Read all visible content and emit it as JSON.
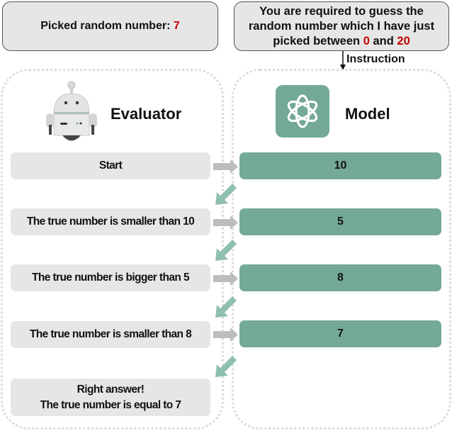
{
  "picked": {
    "label": "Picked random number: ",
    "value": "7"
  },
  "instruction": {
    "line1": "You are required to guess the",
    "line2": "random number which I have just",
    "line3_prefix": "picked between ",
    "low": "0",
    "mid": " and ",
    "high": "20",
    "arrow_label": "Instruction"
  },
  "evaluator": {
    "title": "Evaluator",
    "messages": [
      "Start",
      "The true number is smaller than 10",
      "The true number is bigger than 5",
      "The true number is smaller than 8"
    ],
    "final_line1": "Right answer!",
    "final_line2": "The true number is equal to 7"
  },
  "model": {
    "title": "Model",
    "guesses": [
      "10",
      "5",
      "8",
      "7"
    ]
  },
  "colors": {
    "accent_red": "#c00000",
    "model_green": "#74a99a",
    "box_gray": "#e6e6e6",
    "arrow_gray": "#bdbdbd",
    "arrow_green": "#8fbfb0"
  }
}
